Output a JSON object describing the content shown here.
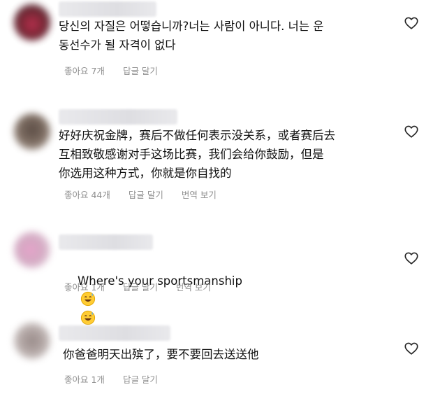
{
  "comments": [
    {
      "text": "당신의 자질은 어떻습니까?너는 사람이 아니다. 너는 운\n동선수가 될 자격이 없다",
      "likes": "좋아요 7개",
      "reply": "답글 달기",
      "translate": "",
      "avatar_color": "#7a1a2a"
    },
    {
      "text": "好好庆祝金牌，赛后不做任何表示没关系，或者赛后去\n互相致敬感谢对手这场比赛，我们会给你鼓励，但是\n你选用这种方式，你就是你自找的",
      "likes": "좋아요 44개",
      "reply": "답글 달기",
      "translate": "번역 보기",
      "avatar_color": "#5a4a40"
    },
    {
      "text": "Where's your sportsmanship",
      "emoji": [
        "sweat-smile-emoji",
        "sweat-smile-emoji"
      ],
      "likes": "좋아요 1개",
      "reply": "답글 달기",
      "translate": "번역 보기",
      "avatar_color": "#d48ab4"
    },
    {
      "text": "你爸爸明天出殡了，要不要回去送送他",
      "likes": "좋아요 1개",
      "reply": "답글 달기",
      "translate": "",
      "avatar_color": "#9a8a88"
    }
  ],
  "icons": {
    "like": "heart-outline-icon"
  },
  "colors": {
    "meta_text": "#8e8e8e",
    "text": "#111111",
    "background": "#ffffff"
  }
}
